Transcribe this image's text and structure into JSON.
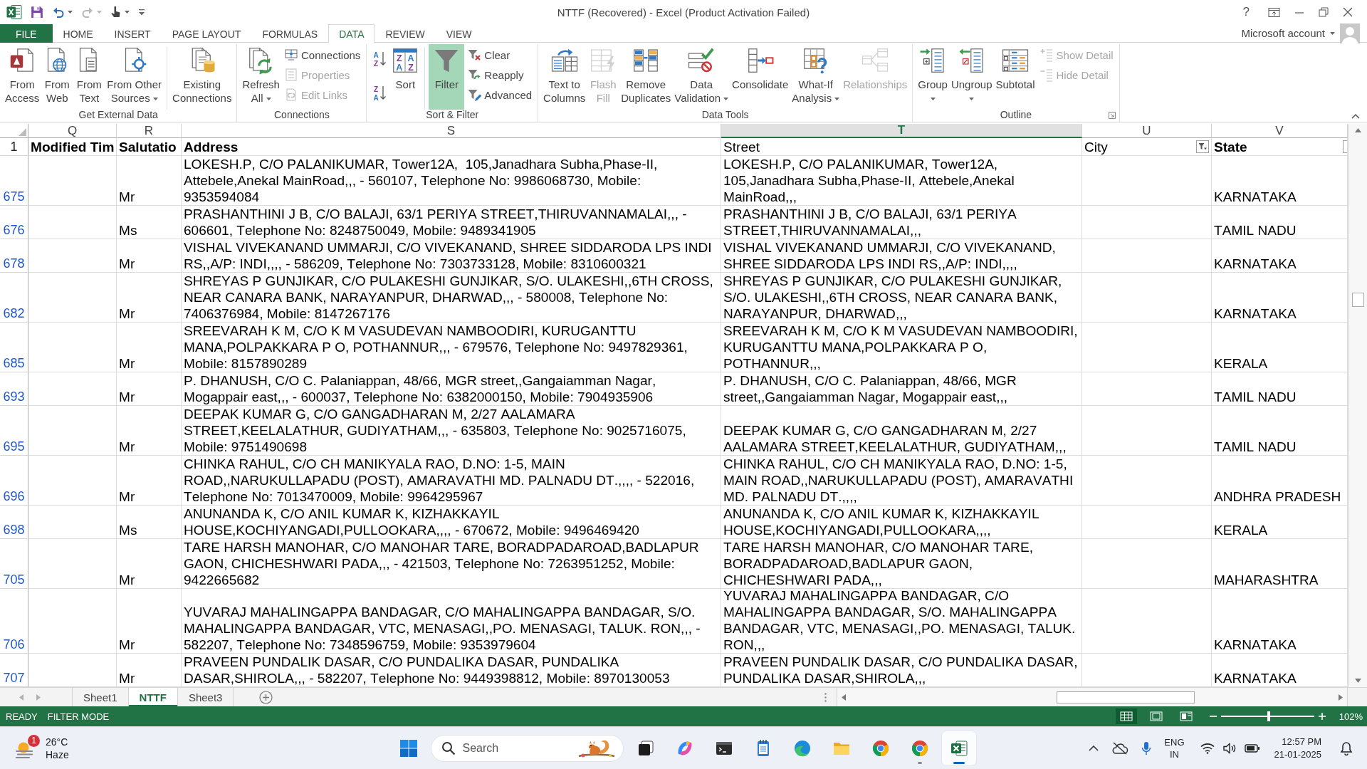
{
  "title_bar": {
    "quick_access": [
      {
        "disabled": false,
        "dropdown": false
      },
      {
        "disabled": false,
        "dropdown": true
      },
      {
        "disabled": true,
        "dropdown": true
      },
      {
        "disabled": false,
        "dropdown": true
      }
    ],
    "title": "NTTF (Recovered) - Excel (Product Activation Failed)",
    "help": "?"
  },
  "ribbon": {
    "tabs": [
      {
        "label": "FILE",
        "kind": "file",
        "selected": false
      },
      {
        "label": "HOME",
        "kind": "tab",
        "selected": false
      },
      {
        "label": "INSERT",
        "kind": "tab",
        "selected": false
      },
      {
        "label": "PAGE LAYOUT",
        "kind": "tab",
        "selected": false
      },
      {
        "label": "FORMULAS",
        "kind": "tab",
        "selected": false
      },
      {
        "label": "DATA",
        "kind": "tab",
        "selected": true
      },
      {
        "label": "REVIEW",
        "kind": "tab",
        "selected": false
      },
      {
        "label": "VIEW",
        "kind": "tab",
        "selected": false
      }
    ],
    "account": "Microsoft account",
    "groups": [
      {
        "label": "Get External Data",
        "columns": [
          {
            "kind": "large",
            "label": "From\nAccess",
            "dropdown": false,
            "disabled": false,
            "on": false
          },
          {
            "kind": "large",
            "label": "From\nWeb",
            "dropdown": false,
            "disabled": false,
            "on": false
          },
          {
            "kind": "large",
            "label": "From\nText",
            "dropdown": false,
            "disabled": false,
            "on": false
          },
          {
            "kind": "large",
            "label": "From Other\nSources",
            "dropdown": true,
            "disabled": false,
            "on": false
          },
          {
            "kind": "large",
            "label": "Existing\nConnections",
            "dropdown": false,
            "disabled": false,
            "on": false,
            "divider": true
          }
        ]
      },
      {
        "label": "Connections",
        "columns": [
          {
            "kind": "large",
            "label": "Refresh\nAll",
            "dropdown": true,
            "disabled": false,
            "on": false
          },
          {
            "kind": "stack",
            "items": [
              {
                "label": "Connections",
                "disabled": false
              },
              {
                "label": "Properties",
                "disabled": true
              },
              {
                "label": "Edit Links",
                "disabled": true
              }
            ]
          }
        ]
      },
      {
        "label": "Sort & Filter",
        "columns": [
          {
            "kind": "sort_pair",
            "items": [
              {
                "letters": [
                  "A",
                  "Z"
                ],
                "disabled": false
              },
              {
                "letters": [
                  "Z",
                  "A"
                ],
                "disabled": false
              }
            ]
          },
          {
            "kind": "large",
            "label": "Sort",
            "letters": [
              "Z",
              "A",
              "A",
              "Z"
            ],
            "dropdown": false,
            "disabled": false,
            "on": false
          },
          {
            "kind": "large",
            "label": "Filter",
            "dropdown": false,
            "disabled": false,
            "on": true,
            "divider": true
          },
          {
            "kind": "stack",
            "items": [
              {
                "label": "Clear",
                "disabled": false
              },
              {
                "label": "Reapply",
                "disabled": false
              },
              {
                "label": "Advanced",
                "disabled": false
              }
            ]
          }
        ]
      },
      {
        "label": "Data Tools",
        "columns": [
          {
            "kind": "large",
            "label": "Text to\nColumns",
            "dropdown": false,
            "disabled": false,
            "on": false
          },
          {
            "kind": "large",
            "label": "Flash\nFill",
            "dropdown": false,
            "disabled": true,
            "on": false
          },
          {
            "kind": "large",
            "label": "Remove\nDuplicates",
            "dropdown": false,
            "disabled": false,
            "on": false
          },
          {
            "kind": "large",
            "label": "Data\nValidation",
            "dropdown": true,
            "disabled": false,
            "on": false
          },
          {
            "kind": "large",
            "label": "Consolidate",
            "dropdown": false,
            "disabled": false,
            "on": false
          },
          {
            "kind": "large",
            "label": "What-If\nAnalysis",
            "dropdown": true,
            "disabled": false,
            "on": false
          },
          {
            "kind": "large",
            "label": "Relationships",
            "dropdown": false,
            "disabled": true,
            "on": false
          }
        ]
      },
      {
        "label": "Outline",
        "dialog_launcher": true,
        "columns": [
          {
            "kind": "large",
            "label": "Group",
            "dropdown": true,
            "disabled": false,
            "on": false
          },
          {
            "kind": "large",
            "label": "Ungroup",
            "dropdown": true,
            "disabled": false,
            "on": false
          },
          {
            "kind": "large",
            "label": "Subtotal",
            "dropdown": false,
            "disabled": false,
            "on": false
          },
          {
            "kind": "stack",
            "items": [
              {
                "label": "Show Detail",
                "disabled": true
              },
              {
                "label": "Hide Detail",
                "disabled": true
              }
            ]
          }
        ]
      }
    ]
  },
  "sheet": {
    "columns": [
      {
        "label": "Q",
        "selected": false
      },
      {
        "label": "R",
        "selected": false
      },
      {
        "label": "S",
        "selected": false
      },
      {
        "label": "T",
        "selected": true
      },
      {
        "label": "U",
        "selected": false
      },
      {
        "label": "V",
        "selected": false
      }
    ],
    "header_row": {
      "row_number": "1",
      "cells": [
        {
          "text": "Modified Tim",
          "bold": true
        },
        {
          "text": "Salutatio",
          "bold": true
        },
        {
          "text": "Address",
          "bold": true
        },
        {
          "text": "Street",
          "bold": false
        },
        {
          "text": "City",
          "bold": false,
          "filter_button": true,
          "filtered": true
        },
        {
          "text": "State",
          "bold": true,
          "filter_button": true,
          "filtered": false
        }
      ]
    },
    "rows": [
      {
        "row_number": "675",
        "salutation": "Mr",
        "address": "LOKESH.P, C/O PALANIKUMAR, Tower12A,  105,Janadhara Subha,Phase-II, Attebele,Anekal MainRoad,,, - 560107, Telephone No: 9986068730, Mobile: 9353594084",
        "street": "LOKESH.P, C/O PALANIKUMAR, Tower12A,  105,Janadhara Subha,Phase-II, Attebele,Anekal MainRoad,,,",
        "state": "KARNATAKA"
      },
      {
        "row_number": "676",
        "salutation": "Ms",
        "address": "PRASHANTHINI J B, C/O BALAJI, 63/1 PERIYA STREET,THIRUVANNAMALAI,,, - 606601, Telephone No: 8248750049, Mobile: 9489341905",
        "street": "PRASHANTHINI J B, C/O BALAJI, 63/1 PERIYA STREET,THIRUVANNAMALAI,,,",
        "state": "TAMIL NADU"
      },
      {
        "row_number": "678",
        "salutation": "Mr",
        "address": "VISHAL VIVEKANAND UMMARJI, C/O VIVEKANAND, SHREE SIDDARODA LPS INDI RS,,A/P: INDI,,,, - 586209, Telephone No: 7303733128, Mobile: 8310600321",
        "street": "VISHAL VIVEKANAND UMMARJI, C/O VIVEKANAND, SHREE SIDDARODA LPS INDI RS,,A/P: INDI,,,,",
        "state": "KARNATAKA"
      },
      {
        "row_number": "682",
        "salutation": "Mr",
        "address": "SHREYAS P GUNJIKAR, C/O PULAKESHI GUNJIKAR, S/O. ULAKESHI,,6TH CROSS, NEAR CANARA BANK, NARAYANPUR, DHARWAD,,, - 580008, Telephone No: 7406376984, Mobile: 8147267176",
        "street": "SHREYAS P GUNJIKAR, C/O PULAKESHI GUNJIKAR, S/O. ULAKESHI,,6TH CROSS, NEAR CANARA BANK, NARAYANPUR, DHARWAD,,,",
        "state": "KARNATAKA"
      },
      {
        "row_number": "685",
        "salutation": "Mr",
        "address": "SREEVARAH K M, C/O K M VASUDEVAN NAMBOODIRI, KURUGANTTU MANA,POLPAKKARA P O, POTHANNUR,,, - 679576, Telephone No: 9497829361, Mobile: 8157890289",
        "street": "SREEVARAH K M, C/O K M VASUDEVAN NAMBOODIRI, KURUGANTTU MANA,POLPAKKARA P O, POTHANNUR,,,",
        "state": "KERALA"
      },
      {
        "row_number": "693",
        "salutation": "Mr",
        "address": "P. DHANUSH, C/O C. Palaniappan, 48/66, MGR street,,Gangaiamman Nagar, Mogappair east,,, - 600037, Telephone No: 6382000150, Mobile: 7904935906",
        "street": "P. DHANUSH, C/O C. Palaniappan, 48/66, MGR street,,Gangaiamman Nagar, Mogappair east,,,",
        "state": "TAMIL NADU"
      },
      {
        "row_number": "695",
        "salutation": "Mr",
        "address": "DEEPAK KUMAR G, C/O GANGADHARAN M, 2/27 AALAMARA STREET,KEELALATHUR, GUDIYATHAM,,, - 635803, Telephone No: 9025716075, Mobile: 9751490698",
        "street": "DEEPAK KUMAR G, C/O GANGADHARAN M, 2/27 AALAMARA STREET,KEELALATHUR, GUDIYATHAM,,,",
        "state": "TAMIL NADU"
      },
      {
        "row_number": "696",
        "salutation": "Mr",
        "address": "CHINKA RAHUL, C/O CH MANIKYALA RAO, D.NO: 1-5, MAIN ROAD,,NARUKULLAPADU (POST), AMARAVATHI MD. PALNADU DT.,,,, - 522016, Telephone No: 7013470009, Mobile: 9964295967",
        "street": "CHINKA RAHUL, C/O CH MANIKYALA RAO, D.NO: 1-5, MAIN ROAD,,NARUKULLAPADU (POST), AMARAVATHI MD. PALNADU DT.,,,,",
        "state": "ANDHRA PRADESH"
      },
      {
        "row_number": "698",
        "salutation": "Ms",
        "address": "ANUNANDA K, C/O ANIL KUMAR K, KIZHAKKAYIL HOUSE,KOCHIYANGADI,PULLOOKARA,,,, - 670672, Mobile: 9496469420",
        "street": "ANUNANDA K, C/O ANIL KUMAR K, KIZHAKKAYIL HOUSE,KOCHIYANGADI,PULLOOKARA,,,,",
        "state": "KERALA"
      },
      {
        "row_number": "705",
        "salutation": "Mr",
        "address": "TARE HARSH MANOHAR, C/O MANOHAR TARE, BORADPADAROAD,BADLAPUR GAON, CHICHESHWARI PADA,,, - 421503, Telephone No: 7263951252, Mobile: 9422665682",
        "street": "TARE HARSH MANOHAR, C/O MANOHAR TARE, BORADPADAROAD,BADLAPUR GAON, CHICHESHWARI PADA,,,",
        "state": "MAHARASHTRA"
      },
      {
        "row_number": "706",
        "salutation": "Mr",
        "address": "YUVARAJ MAHALINGAPPA BANDAGAR, C/O MAHALINGAPPA BANDAGAR, S/O. MAHALINGAPPA BANDAGAR, VTC, MENASAGI,,PO. MENASAGI, TALUK. RON,,, - 582207, Telephone No: 7348596759, Mobile: 9353979604",
        "street": "YUVARAJ MAHALINGAPPA BANDAGAR, C/O MAHALINGAPPA BANDAGAR, S/O. MAHALINGAPPA BANDAGAR, VTC, MENASAGI,,PO. MENASAGI, TALUK. RON,,,",
        "state": "KARNATAKA"
      },
      {
        "row_number": "707",
        "salutation": "Mr",
        "address": "PRAVEEN PUNDALIK DASAR, C/O PUNDALIKA DASAR, PUNDALIKA DASAR,SHIROLA,,, - 582207, Telephone No: 9449398812, Mobile: 8970130053",
        "street": "PRAVEEN PUNDALIK DASAR, C/O PUNDALIKA DASAR, PUNDALIKA DASAR,SHIROLA,,,",
        "state": "KARNATAKA"
      }
    ]
  },
  "sheet_tabs": {
    "tabs": [
      {
        "label": "Sheet1",
        "selected": false
      },
      {
        "label": "NTTF",
        "selected": true
      },
      {
        "label": "Sheet3",
        "selected": false
      }
    ]
  },
  "status_bar": {
    "mode": "READY",
    "filter": "FILTER MODE",
    "views": [
      {
        "selected": true
      },
      {
        "selected": false
      },
      {
        "selected": false
      }
    ],
    "zoom": {
      "level": 0.51,
      "reading": "102%"
    }
  },
  "taskbar": {
    "weather": {
      "badge": "1",
      "temperature": "26°C",
      "condition": "Haze"
    },
    "search": {
      "placeholder": "Search"
    },
    "apps": [
      {
        "running": false,
        "active": false
      },
      {
        "running": false,
        "active": false
      },
      {
        "running": false,
        "active": false
      },
      {
        "running": false,
        "active": false
      },
      {
        "running": false,
        "active": false
      },
      {
        "running": false,
        "active": false
      },
      {
        "running": false,
        "active": false
      },
      {
        "running": true,
        "active": false
      },
      {
        "running": true,
        "active": true
      }
    ],
    "tray": {
      "language": "ENG",
      "region": "IN",
      "time": "12:57 PM",
      "date": "21-01-2025"
    }
  }
}
